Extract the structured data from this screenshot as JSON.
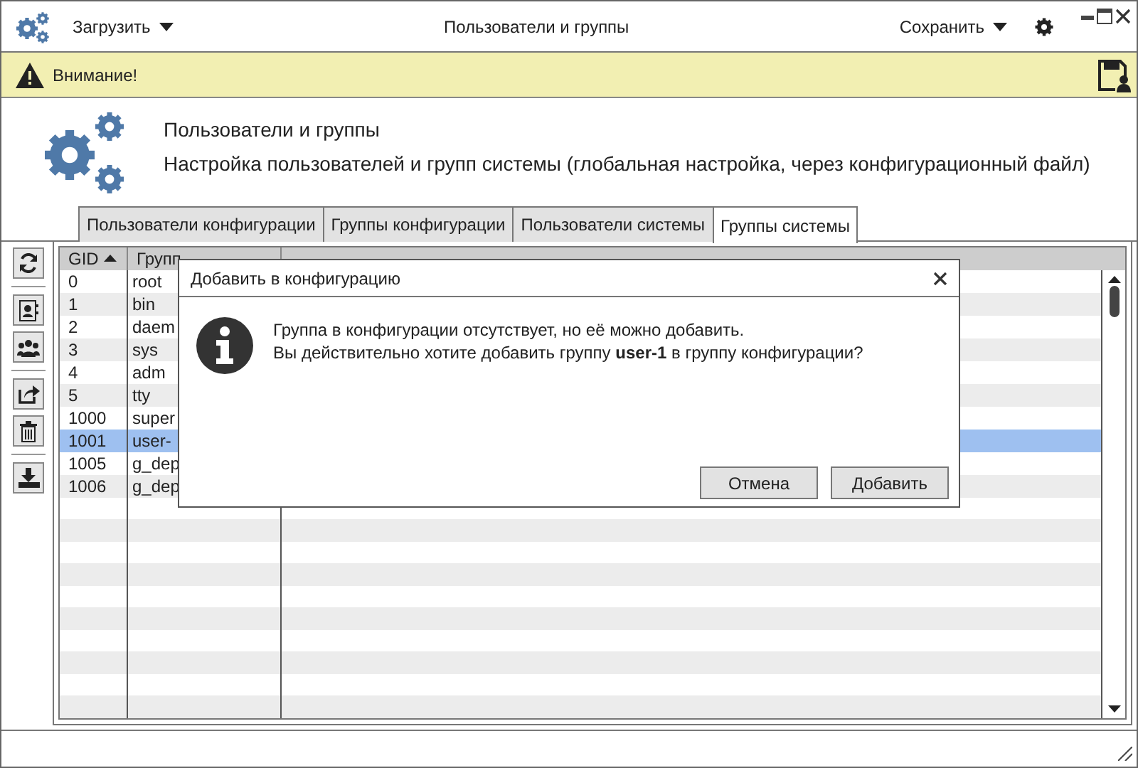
{
  "window": {
    "title": "Пользователи и группы",
    "load_menu": "Загрузить",
    "save_menu": "Сохранить"
  },
  "warning": {
    "text": "Внимание!"
  },
  "header": {
    "title": "Пользователи и группы",
    "subtitle": "Настройка пользователей и групп системы (глобальная настройка, через конфигурационный файл)"
  },
  "tabs": [
    {
      "label": "Пользователи конфигурации",
      "selected": false
    },
    {
      "label": "Группы конфигурации",
      "selected": false
    },
    {
      "label": "Пользователи системы",
      "selected": false
    },
    {
      "label": "Группы системы",
      "selected": true
    }
  ],
  "table": {
    "columns": [
      {
        "label": "GID",
        "sorted": true
      },
      {
        "label": "Групп",
        "sorted": false
      }
    ],
    "rows": [
      {
        "gid": "0",
        "group": "root",
        "selected": false
      },
      {
        "gid": "1",
        "group": "bin",
        "selected": false
      },
      {
        "gid": "2",
        "group": "daem",
        "selected": false
      },
      {
        "gid": "3",
        "group": "sys",
        "selected": false
      },
      {
        "gid": "4",
        "group": "adm",
        "selected": false
      },
      {
        "gid": "5",
        "group": "tty",
        "selected": false
      },
      {
        "gid": "1000",
        "group": "super",
        "selected": false
      },
      {
        "gid": "1001",
        "group": "user-",
        "selected": true
      },
      {
        "gid": "1005",
        "group": "g_dep",
        "selected": false
      },
      {
        "gid": "1006",
        "group": "g_dep",
        "selected": false
      }
    ]
  },
  "dialog": {
    "title": "Добавить в конфигурацию",
    "lines": [
      "Группа в конфигурации отсутствует, но её можно добавить.",
      "Вы действительно хотите добавить группу **user-1** в группу конфигурации?"
    ],
    "buttons": [
      "Отмена",
      "Добавить"
    ]
  }
}
